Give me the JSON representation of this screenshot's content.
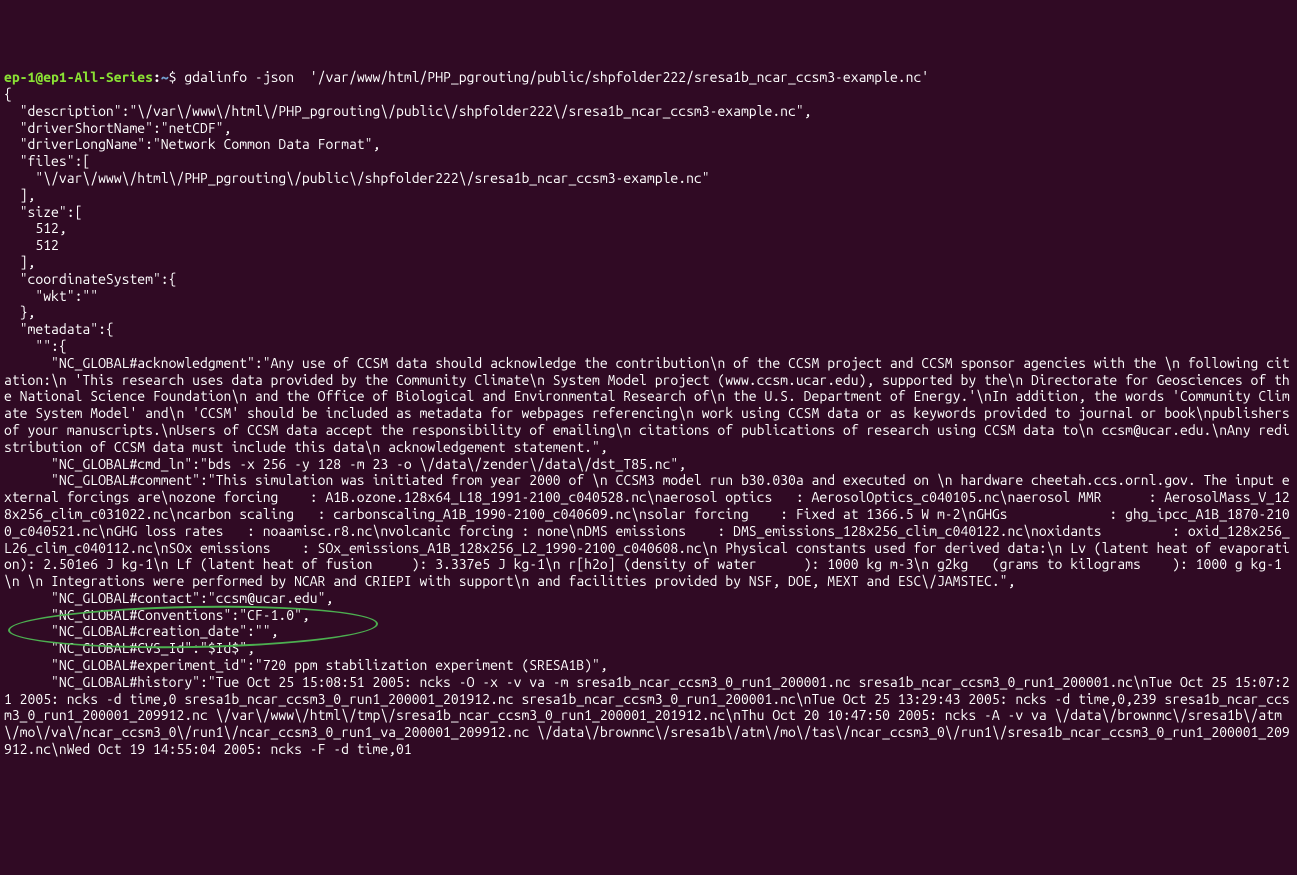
{
  "prompt": {
    "user_host": "ep-1@ep1-All-Series",
    "path": "~",
    "symbol": "$"
  },
  "command": "gdalinfo -json  '/var/www/html/PHP_pgrouting/public/shpfolder222/sresa1b_ncar_ccsm3-example.nc'",
  "output_lines": [
    "{",
    "  \"description\":\"\\/var\\/www\\/html\\/PHP_pgrouting\\/public\\/shpfolder222\\/sresa1b_ncar_ccsm3-example.nc\",",
    "  \"driverShortName\":\"netCDF\",",
    "  \"driverLongName\":\"Network Common Data Format\",",
    "  \"files\":[",
    "    \"\\/var\\/www\\/html\\/PHP_pgrouting\\/public\\/shpfolder222\\/sresa1b_ncar_ccsm3-example.nc\"",
    "  ],",
    "  \"size\":[",
    "    512,",
    "    512",
    "  ],",
    "  \"coordinateSystem\":{",
    "    \"wkt\":\"\"",
    "  },",
    "  \"metadata\":{",
    "    \"\":{",
    "      \"NC_GLOBAL#acknowledgment\":\"Any use of CCSM data should acknowledge the contribution\\n of the CCSM project and CCSM sponsor agencies with the \\n following citation:\\n 'This research uses data provided by the Community Climate\\n System Model project (www.ccsm.ucar.edu), supported by the\\n Directorate for Geosciences of the National Science Foundation\\n and the Office of Biological and Environmental Research of\\n the U.S. Department of Energy.'\\nIn addition, the words 'Community Climate System Model' and\\n 'CCSM' should be included as metadata for webpages referencing\\n work using CCSM data or as keywords provided to journal or book\\npublishers of your manuscripts.\\nUsers of CCSM data accept the responsibility of emailing\\n citations of publications of research using CCSM data to\\n ccsm@ucar.edu.\\nAny redistribution of CCSM data must include this data\\n acknowledgement statement.\",",
    "      \"NC_GLOBAL#cmd_ln\":\"bds -x 256 -y 128 -m 23 -o \\/data\\/zender\\/data\\/dst_T85.nc\",",
    "      \"NC_GLOBAL#comment\":\"This simulation was initiated from year 2000 of \\n CCSM3 model run b30.030a and executed on \\n hardware cheetah.ccs.ornl.gov. The input external forcings are\\nozone forcing    : A1B.ozone.128x64_L18_1991-2100_c040528.nc\\naerosol optics   : AerosolOptics_c040105.nc\\naerosol MMR      : AerosolMass_V_128x256_clim_c031022.nc\\ncarbon scaling   : carbonscaling_A1B_1990-2100_c040609.nc\\nsolar forcing    : Fixed at 1366.5 W m-2\\nGHGs             : ghg_ipcc_A1B_1870-2100_c040521.nc\\nGHG loss rates   : noaamisc.r8.nc\\nvolcanic forcing : none\\nDMS emissions    : DMS_emissions_128x256_clim_c040122.nc\\noxidants         : oxid_128x256_L26_clim_c040112.nc\\nSOx emissions    : SOx_emissions_A1B_128x256_L2_1990-2100_c040608.nc\\n Physical constants used for derived data:\\n Lv (latent heat of evaporation): 2.501e6 J kg-1\\n Lf (latent heat of fusion     ): 3.337e5 J kg-1\\n r[h2o] (density of water      ): 1000 kg m-3\\n g2kg   (grams to kilograms    ): 1000 g kg-1\\n \\n Integrations were performed by NCAR and CRIEPI with support\\n and facilities provided by NSF, DOE, MEXT and ESC\\/JAMSTEC.\",",
    "      \"NC_GLOBAL#contact\":\"ccsm@ucar.edu\",",
    "      \"NC_GLOBAL#Conventions\":\"CF-1.0\",",
    "      \"NC_GLOBAL#creation_date\":\"\",",
    "      \"NC_GLOBAL#CVS_Id\":\"$Id$\",",
    "      \"NC_GLOBAL#experiment_id\":\"720 ppm stabilization experiment (SRESA1B)\",",
    "      \"NC_GLOBAL#history\":\"Tue Oct 25 15:08:51 2005: ncks -O -x -v va -m sresa1b_ncar_ccsm3_0_run1_200001.nc sresa1b_ncar_ccsm3_0_run1_200001.nc\\nTue Oct 25 15:07:21 2005: ncks -d time,0 sresa1b_ncar_ccsm3_0_run1_200001_201912.nc sresa1b_ncar_ccsm3_0_run1_200001.nc\\nTue Oct 25 13:29:43 2005: ncks -d time,0,239 sresa1b_ncar_ccsm3_0_run1_200001_209912.nc \\/var\\/www\\/html\\/tmp\\/sresa1b_ncar_ccsm3_0_run1_200001_201912.nc\\nThu Oct 20 10:47:50 2005: ncks -A -v va \\/data\\/brownmc\\/sresa1b\\/atm\\/mo\\/va\\/ncar_ccsm3_0\\/run1\\/ncar_ccsm3_0_run1_va_200001_209912.nc \\/data\\/brownmc\\/sresa1b\\/atm\\/mo\\/tas\\/ncar_ccsm3_0\\/run1\\/sresa1b_ncar_ccsm3_0_run1_200001_209912.nc\\nWed Oct 19 14:55:04 2005: ncks -F -d time,01"
  ]
}
